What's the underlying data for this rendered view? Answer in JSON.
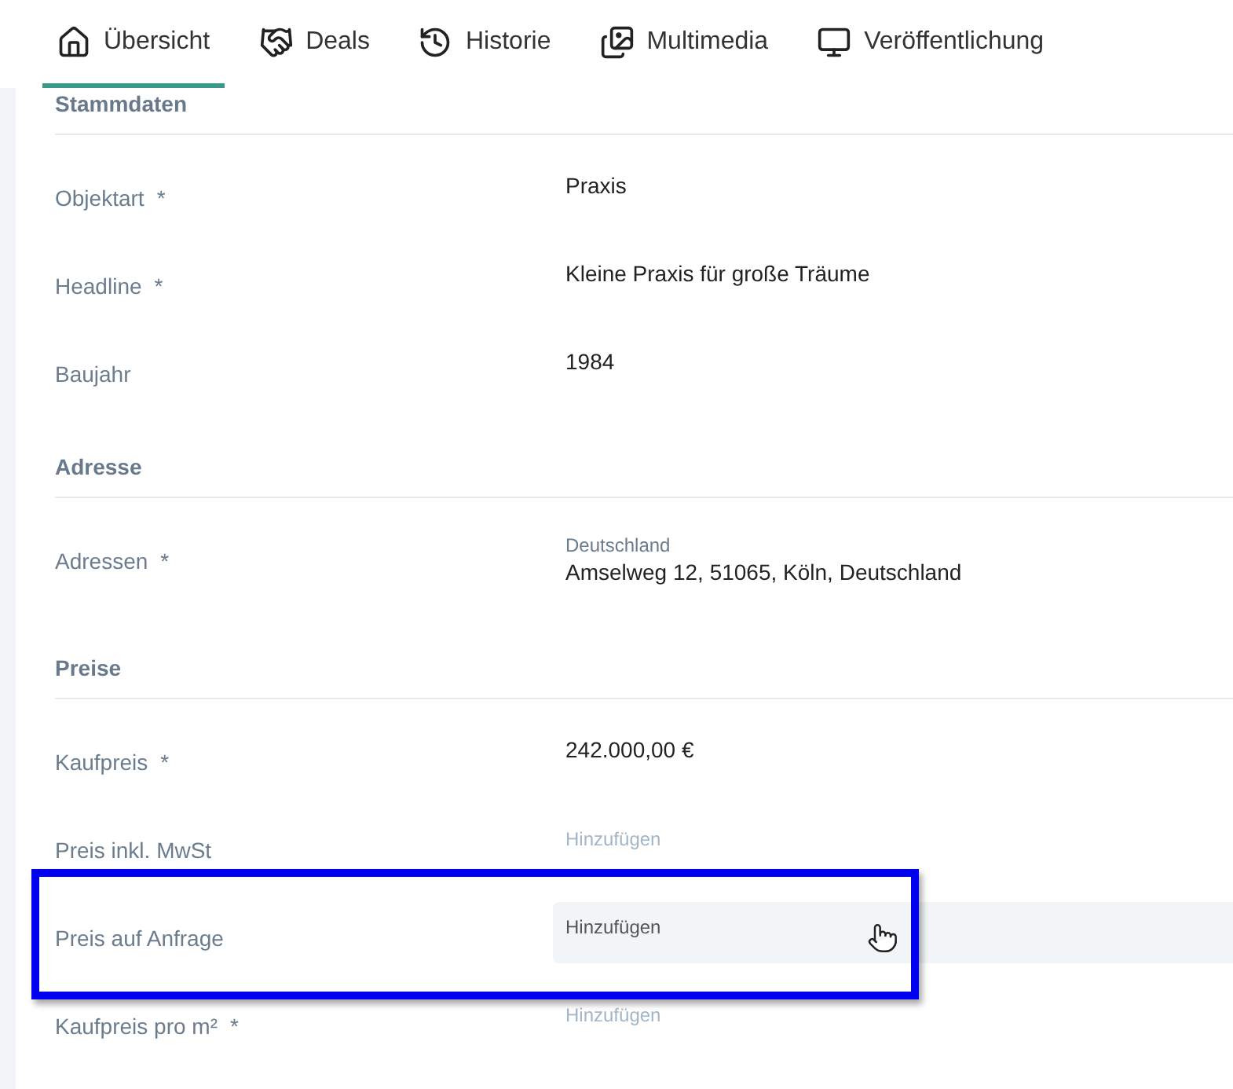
{
  "tabs": [
    {
      "label": "Übersicht",
      "selected": true
    },
    {
      "label": "Deals",
      "selected": false
    },
    {
      "label": "Historie",
      "selected": false
    },
    {
      "label": "Multimedia",
      "selected": false
    },
    {
      "label": "Veröffentlichung",
      "selected": false
    }
  ],
  "sections": [
    {
      "title": "Stammdaten",
      "fields": [
        {
          "label": "Objektart",
          "mark": "*",
          "kind": "value",
          "value": "Praxis"
        },
        {
          "label": "Headline",
          "mark": "*",
          "kind": "value",
          "value": "Kleine Praxis für große Träume"
        },
        {
          "label": "Baujahr",
          "kind": "value",
          "value": "1984"
        }
      ]
    },
    {
      "title": "Adresse",
      "fields": [
        {
          "label": "Adressen",
          "mark": "*",
          "kind": "address",
          "subtitle": "Deutschland",
          "value": "Amselweg 12, 51065, Köln, Deutschland"
        }
      ]
    },
    {
      "title": "Preise",
      "fields": [
        {
          "label": "Kaufpreis",
          "mark": "*",
          "kind": "value",
          "value": "242.000,00 €"
        },
        {
          "label": "Preis inkl. MwSt",
          "kind": "add",
          "value": "Hinzufügen",
          "hovered": false,
          "annotated": false
        },
        {
          "label": "Preis auf Anfrage",
          "kind": "add",
          "value": "Hinzufügen",
          "hovered": true,
          "annotated": true
        },
        {
          "label": "Kaufpreis pro m²",
          "mark": "*",
          "kind": "add",
          "value": "Hinzufügen",
          "hovered": false,
          "annotated": false
        }
      ]
    }
  ]
}
